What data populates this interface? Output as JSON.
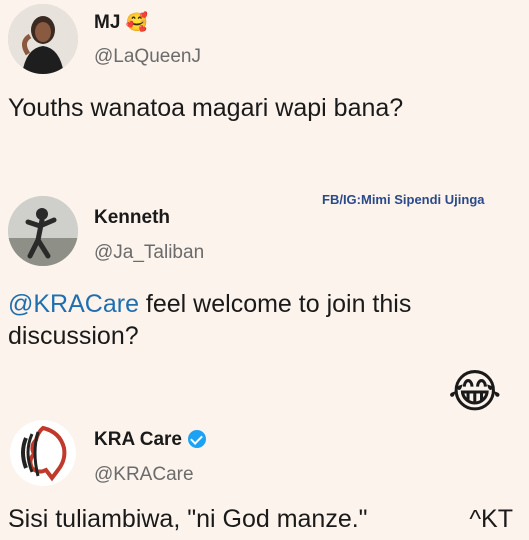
{
  "tweets": [
    {
      "name": "MJ",
      "name_emoji": "🥰",
      "handle": "@LaQueenJ",
      "text": "Youths wanatoa magari wapi bana?"
    },
    {
      "name": "Kenneth",
      "handle": "@Ja_Taliban",
      "mention": "@KRACare",
      "text_line1_rest": " feel welcome to join this",
      "text_line2": "discussion?"
    },
    {
      "name": "KRA Care",
      "handle": "@KRACare",
      "text": "Sisi tuliambiwa, \"ni God manze.\"",
      "signature": "^KT"
    }
  ],
  "watermark": "FB/IG:Mimi Sipendi Ujinga",
  "reaction_emoji": "😂",
  "colors": {
    "background": "#fbf3ec",
    "mention": "#1f6fb0",
    "verified": "#1da1f2",
    "watermark": "#2a4a8a"
  }
}
